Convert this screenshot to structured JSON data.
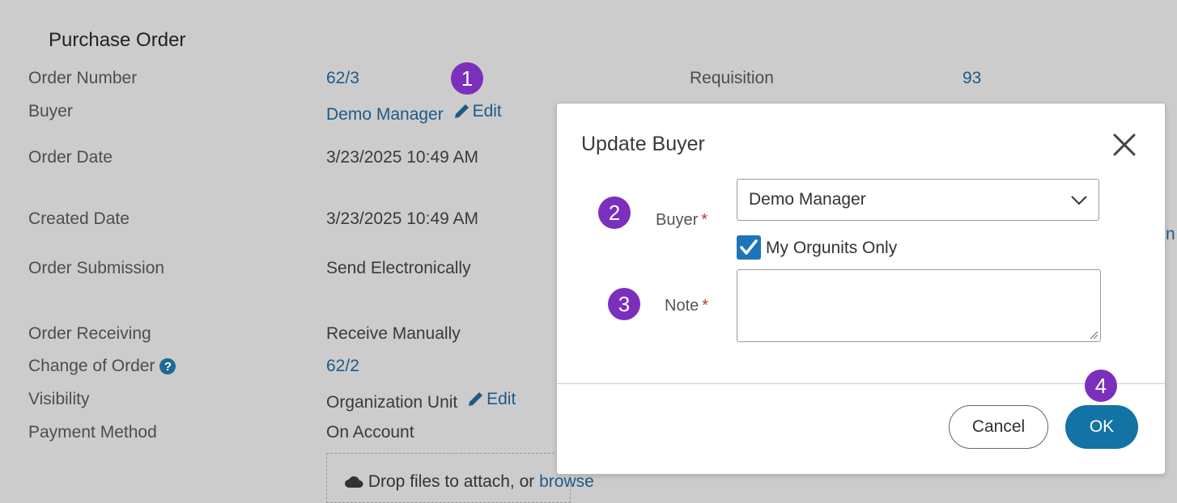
{
  "page": {
    "title": "Purchase Order",
    "fields": [
      {
        "label": "Order Number",
        "value": "62/3"
      },
      {
        "label": "Buyer",
        "value": "Demo Manager",
        "edit": "Edit"
      },
      {
        "label": "Order Date",
        "value": "3/23/2025 10:49 AM"
      },
      {
        "label": "Created Date",
        "value": "3/23/2025 10:49 AM"
      },
      {
        "label": "Order Submission",
        "value": "Send Electronically"
      },
      {
        "label": "Order Receiving",
        "value": "Receive Manually"
      },
      {
        "label": "Change of Order",
        "value": "62/2",
        "help": "?"
      },
      {
        "label": "Visibility",
        "value": "Organization Unit",
        "edit": "Edit"
      },
      {
        "label": "Payment Method",
        "value": "On Account"
      }
    ],
    "requisition": {
      "label": "Requisition",
      "value": "93"
    },
    "attach": {
      "text": "Drop files to attach, or ",
      "link": "browse"
    },
    "partial_link": "n"
  },
  "modal": {
    "title": "Update Buyer",
    "buyer_label": "Buyer",
    "buyer_value": "Demo Manager",
    "orgunits_label": "My Orgunits Only",
    "orgunits_checked": true,
    "note_label": "Note",
    "note_value": "",
    "required_mark": "*",
    "cancel": "Cancel",
    "ok": "OK"
  },
  "badges": [
    "1",
    "2",
    "3",
    "4"
  ],
  "colors": {
    "badge": "#7b2fbd",
    "link": "#1d5a87",
    "primary": "#1273a4",
    "checkbox": "#1d75b8",
    "required": "#c0392b"
  },
  "icons": [
    "pencil-icon",
    "question-circle-icon",
    "close-icon",
    "chevron-down-icon",
    "check-icon",
    "cloud-upload-icon",
    "resize-handle-icon"
  ]
}
